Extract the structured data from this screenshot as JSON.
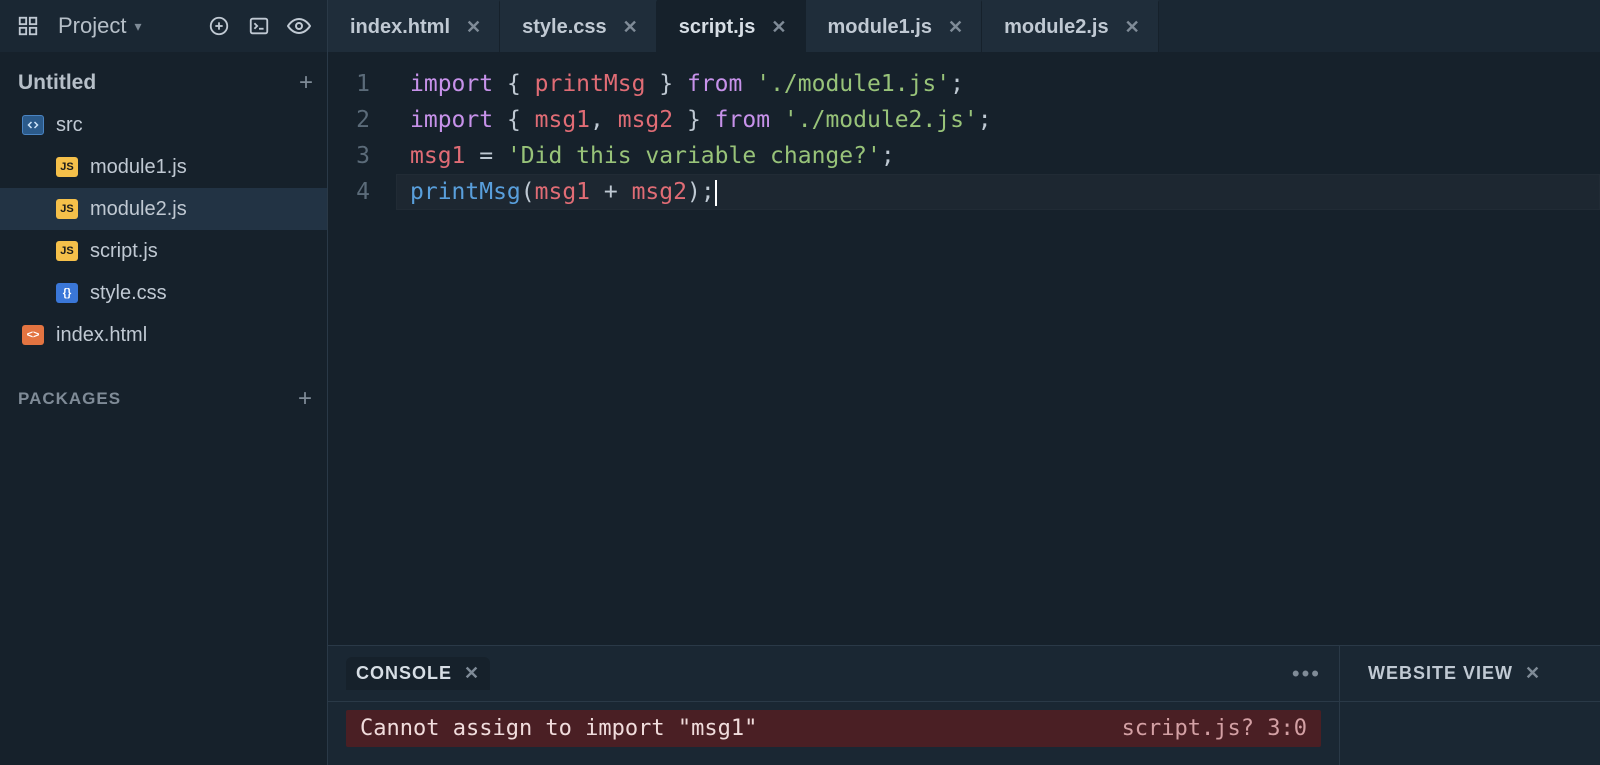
{
  "topbar": {
    "menu_label": "Project",
    "tabs": [
      {
        "label": "index.html",
        "active": false
      },
      {
        "label": "style.css",
        "active": false
      },
      {
        "label": "script.js",
        "active": true
      },
      {
        "label": "module1.js",
        "active": false
      },
      {
        "label": "module2.js",
        "active": false
      }
    ]
  },
  "sidebar": {
    "title": "Untitled",
    "packages_label": "PACKAGES",
    "tree": {
      "root": "src",
      "files": [
        {
          "name": "module1.js",
          "type": "js",
          "selected": false
        },
        {
          "name": "module2.js",
          "type": "js",
          "selected": true
        },
        {
          "name": "script.js",
          "type": "js",
          "selected": false
        },
        {
          "name": "style.css",
          "type": "css",
          "selected": false
        }
      ],
      "root_files": [
        {
          "name": "index.html",
          "type": "html"
        }
      ]
    }
  },
  "editor": {
    "active_line": 4,
    "lines": [
      [
        {
          "t": "kw",
          "s": "import"
        },
        {
          "t": "pl",
          "s": " { "
        },
        {
          "t": "id",
          "s": "printMsg"
        },
        {
          "t": "pl",
          "s": " } "
        },
        {
          "t": "kw",
          "s": "from"
        },
        {
          "t": "pl",
          "s": " "
        },
        {
          "t": "str",
          "s": "'./module1.js'"
        },
        {
          "t": "pl",
          "s": ";"
        }
      ],
      [
        {
          "t": "kw",
          "s": "import"
        },
        {
          "t": "pl",
          "s": " { "
        },
        {
          "t": "id",
          "s": "msg1"
        },
        {
          "t": "pl",
          "s": ", "
        },
        {
          "t": "id",
          "s": "msg2"
        },
        {
          "t": "pl",
          "s": " } "
        },
        {
          "t": "kw",
          "s": "from"
        },
        {
          "t": "pl",
          "s": " "
        },
        {
          "t": "str",
          "s": "'./module2.js'"
        },
        {
          "t": "pl",
          "s": ";"
        }
      ],
      [
        {
          "t": "id",
          "s": "msg1"
        },
        {
          "t": "pl",
          "s": " = "
        },
        {
          "t": "str",
          "s": "'Did this variable change?'"
        },
        {
          "t": "pl",
          "s": ";"
        }
      ],
      [
        {
          "t": "fn",
          "s": "printMsg"
        },
        {
          "t": "pl",
          "s": "("
        },
        {
          "t": "id",
          "s": "msg1"
        },
        {
          "t": "pl",
          "s": " + "
        },
        {
          "t": "id",
          "s": "msg2"
        },
        {
          "t": "pl",
          "s": ");"
        }
      ]
    ]
  },
  "bottom": {
    "console_label": "CONSOLE",
    "website_label": "WEBSITE VIEW",
    "error": {
      "message": "Cannot assign to import \"msg1\"",
      "location": "script.js? 3:0"
    }
  }
}
